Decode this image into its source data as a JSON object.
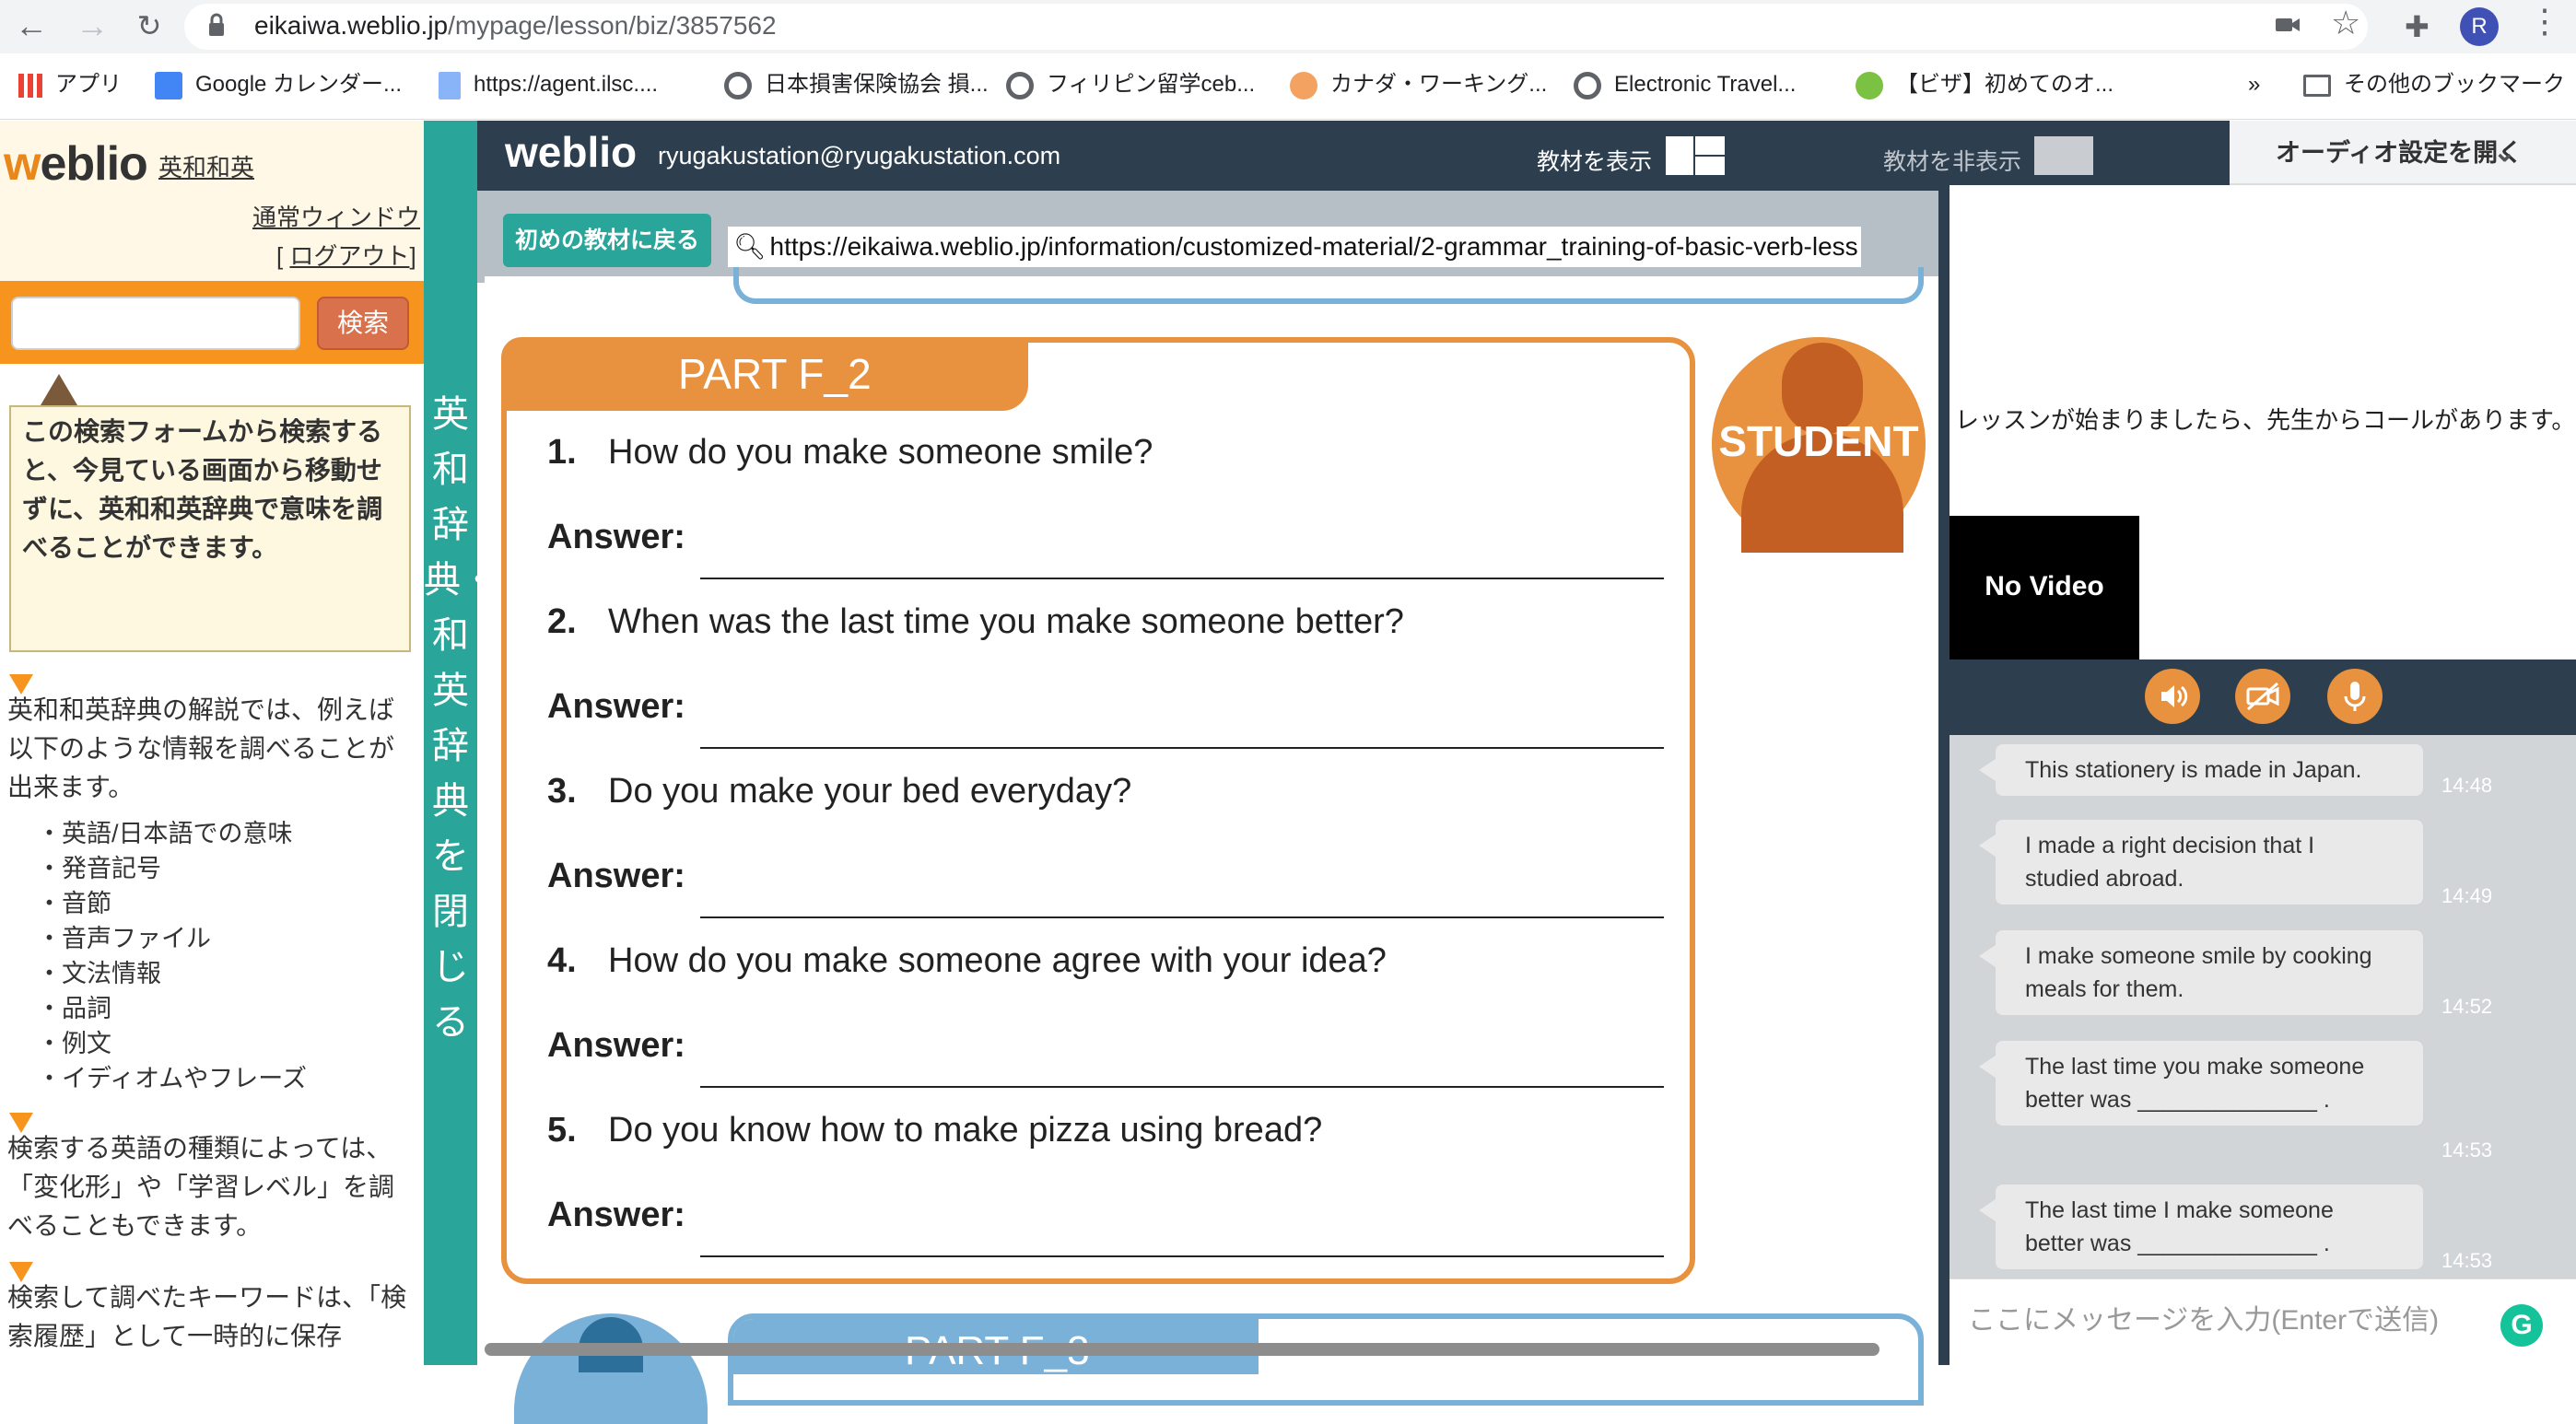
{
  "browser": {
    "url_host": "eikaiwa.weblio.jp",
    "url_path": "/mypage/lesson/biz/3857562",
    "profile_initial": "R",
    "bookmarks": [
      {
        "label": "アプリ",
        "icon": "apps-grid-icon",
        "color": "#ea4335"
      },
      {
        "label": "Google カレンダー...",
        "icon": "calendar-icon",
        "color": "#4285f4"
      },
      {
        "label": "https://agent.ilsc....",
        "icon": "document-icon",
        "color": "#8ab4f8"
      },
      {
        "label": "日本損害保険協会 損...",
        "icon": "globe-icon",
        "color": "#5f6368"
      },
      {
        "label": "フィリピン留学ceb...",
        "icon": "globe-icon",
        "color": "#5f6368"
      },
      {
        "label": "カナダ・ワーキング...",
        "icon": "hand-icon",
        "color": "#f4a261"
      },
      {
        "label": "Electronic Travel...",
        "icon": "globe-icon",
        "color": "#5f6368"
      },
      {
        "label": "【ビザ】初めてのオ...",
        "icon": "clover-icon",
        "color": "#7cc242"
      }
    ],
    "more": "»",
    "other_bookmarks": "その他のブックマーク"
  },
  "sidebar": {
    "logo_w": "w",
    "logo_rest": "eblio",
    "logo_sub": "英和和英",
    "normal_window": "通常ウィンドウ",
    "logout_open": "[ ",
    "logout": "ログアウト",
    "logout_close": "]",
    "search_button": "検索",
    "search_value": "",
    "tip": "この検索フォームから検索すると、今見ている画面から移動せずに、英和和英辞典で意味を調べることができます。",
    "para1": "英和和英辞典の解説では、例えば以下のような情報を調べることが出来ます。",
    "list": [
      "・英語/日本語での意味",
      "・発音記号",
      "・音節",
      "・音声ファイル",
      "・文法情報",
      "・品詞",
      "・例文",
      "・イディオムやフレーズ"
    ],
    "para2": "検索する英語の種類によっては、「変化形」や「学習レベル」を調べることもできます。",
    "para3": "検索して調べたキーワードは、「検索履歴」として一時的に保存"
  },
  "tealbar": {
    "label": "英和辞典・和英辞典を閉じる"
  },
  "app": {
    "logo": "weblio",
    "email": "ryugakustation@ryugakustation.com",
    "show_material": "教材を表示",
    "hide_material": "教材を非表示",
    "audio_settings": "オーディオ設定を開く",
    "back_button": "初めの教材に戻る",
    "material_url": "https://eikaiwa.weblio.jp/information/customized-material/2-grammar_training-of-basic-verb-less"
  },
  "material": {
    "part_title": "PART F_2",
    "role_badge": "STUDENT",
    "answer_label": "Answer:",
    "questions": [
      {
        "num": "1.",
        "text": "How do you make someone smile?"
      },
      {
        "num": "2.",
        "text": "When was the last time you make someone better?"
      },
      {
        "num": "3.",
        "text": "Do you make your bed everyday?"
      },
      {
        "num": "4.",
        "text": "How do you make someone agree with your idea?"
      },
      {
        "num": "5.",
        "text": "Do you know how to make pizza using bread?"
      }
    ],
    "next_part_title": "PART F_3"
  },
  "right_panel": {
    "lesson_message": "レッスンが始まりましたら、先生からコールがあります。",
    "no_video": "No Video",
    "chat": [
      {
        "text": "This stationery is made in Japan.",
        "time": "14:48"
      },
      {
        "text": "I made a right decision that I studied abroad.",
        "time": "14:49"
      },
      {
        "text": "I make someone smile by cooking meals for them.",
        "time": "14:52"
      },
      {
        "text": "The last time you make someone better was ______________ .",
        "time": "14:53"
      },
      {
        "text": "The last time I make someone better was ______________ .",
        "time": "14:53"
      }
    ],
    "chat_placeholder": "ここにメッセージを入力(Enterで送信)",
    "grammarly": "G"
  },
  "colors": {
    "accent_orange": "#e8913e",
    "teal": "#2aa59a",
    "navy": "#2d3e4f",
    "blue_frame": "#7ab1d8"
  }
}
